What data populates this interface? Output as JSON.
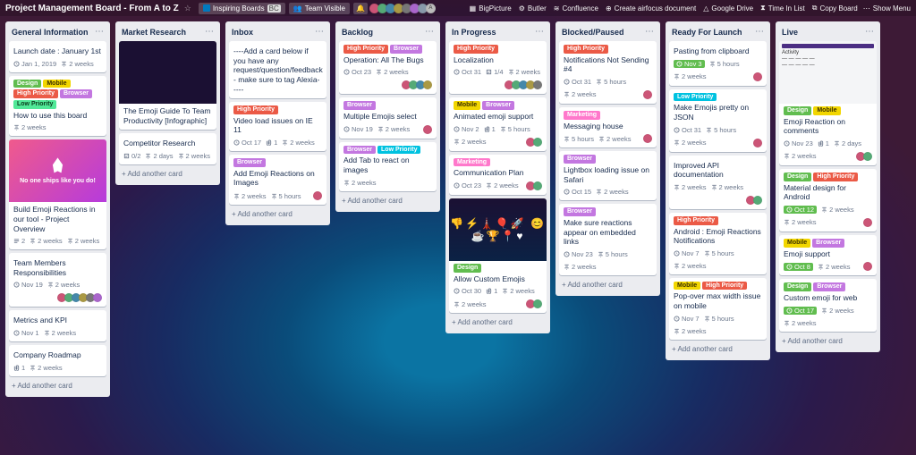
{
  "topbar": {
    "title": "Project Management Board - From A to Z",
    "team_button": "Inspiring Boards",
    "team_initials": "BC",
    "visibility": "Team Visible",
    "powerups": [
      "BigPicture",
      "Butler",
      "Confluence",
      "Create airfocus document",
      "Google Drive",
      "Time In List",
      "Copy Board"
    ],
    "show_menu": "Show Menu"
  },
  "add_card": "Add another card",
  "lists": [
    {
      "title": "General Information",
      "cards": [
        {
          "title": "Launch date : January 1st",
          "date": "Jan 1, 2019",
          "tl": "2 weeks"
        },
        {
          "labels": [
            [
              "green",
              "Design"
            ],
            [
              "yellow",
              "Mobile"
            ],
            [
              "red",
              "High Priority"
            ],
            [
              "purple",
              "Browser"
            ],
            [
              "lime",
              "Low Priority"
            ]
          ],
          "title": "How to use this board",
          "tl": "2 weeks"
        },
        {
          "cover": "rocket",
          "cover_text": "No one ships like you do!",
          "title": "Build Emoji Reactions in our tool - Project Overview",
          "sub": "2",
          "tl": "2 weeks",
          "tl2": "2 weeks"
        },
        {
          "title": "Team Members Responsibilities",
          "date": "Nov 19",
          "tl": "2 weeks",
          "avs": 6
        },
        {
          "title": "Metrics and KPI",
          "date": "Nov 1",
          "tl": "2 weeks"
        },
        {
          "title": "Company Roadmap",
          "att": "1",
          "tl": "2 weeks"
        }
      ]
    },
    {
      "title": "Market Research",
      "cards": [
        {
          "cover": "dark",
          "title": "The Emoji Guide To Team Productivity [Infographic]"
        },
        {
          "title": "Competitor Research",
          "check": "0/2",
          "tl": "2 days",
          "tl2": "2 weeks"
        }
      ]
    },
    {
      "title": "Inbox",
      "cards": [
        {
          "title": "----Add a card below if you have any request/question/feedback - make sure to tag Alexia-----"
        },
        {
          "labels": [
            [
              "red",
              "High Priority"
            ]
          ],
          "title": "Video load issues on IE 11",
          "date": "Oct 17",
          "att": "1",
          "tl": "2 weeks"
        },
        {
          "labels": [
            [
              "purple",
              "Browser"
            ]
          ],
          "title": "Add Emoji Reactions on Images",
          "tl": "2 weeks",
          "tl2": "5 hours",
          "avs": 1
        }
      ]
    },
    {
      "title": "Backlog",
      "cards": [
        {
          "labels": [
            [
              "red",
              "High Priority"
            ],
            [
              "purple",
              "Browser"
            ]
          ],
          "title": "Operation: All The Bugs",
          "date": "Oct 23",
          "tl": "2 weeks",
          "avs": 4
        },
        {
          "labels": [
            [
              "purple",
              "Browser"
            ]
          ],
          "title": "Multiple Emojis select",
          "date": "Nov 19",
          "tl": "2 weeks",
          "avs": 1
        },
        {
          "labels": [
            [
              "purple",
              "Browser"
            ],
            [
              "sky",
              "Low Priority"
            ]
          ],
          "title": "Add Tab to react on images",
          "tl": "2 weeks"
        }
      ]
    },
    {
      "title": "In Progress",
      "cards": [
        {
          "labels": [
            [
              "red",
              "High Priority"
            ]
          ],
          "title": "Localization",
          "date": "Oct 31",
          "check": "1/4",
          "tl": "2 weeks",
          "avs": 5
        },
        {
          "labels": [
            [
              "yellow",
              "Mobile"
            ],
            [
              "purple",
              "Browser"
            ]
          ],
          "title": "Animated emoji support",
          "date": "Nov 2",
          "att": "1",
          "tl": "5 hours",
          "tl2": "2 weeks",
          "avs": 2
        },
        {
          "labels": [
            [
              "pink",
              "Marketing"
            ]
          ],
          "title": "Communication Plan",
          "date": "Oct 23",
          "tl": "2 weeks",
          "avs": 2
        },
        {
          "cover": "emoji",
          "cover_text": "👎⚡🗼🎈🚀\n😊☕🏆📍♥",
          "labels": [
            [
              "green",
              "Design"
            ]
          ],
          "title": "Allow Custom Emojis",
          "date": "Oct 30",
          "att": "1",
          "tl": "2 weeks",
          "tl2": "2 weeks",
          "avs": 2
        }
      ]
    },
    {
      "title": "Blocked/Paused",
      "cards": [
        {
          "labels": [
            [
              "red",
              "High Priority"
            ]
          ],
          "title": "Notifications Not Sending #4",
          "date": "Oct 31",
          "tl": "5 hours",
          "tl2": "2 weeks",
          "avs": 1
        },
        {
          "labels": [
            [
              "pink",
              "Marketing"
            ]
          ],
          "title": "Messaging house",
          "tl": "5 hours",
          "tl2": "2 weeks",
          "avs": 1
        },
        {
          "labels": [
            [
              "purple",
              "Browser"
            ]
          ],
          "title": "Lightbox loading issue on Safari",
          "date": "Oct 15",
          "tl": "2 weeks"
        },
        {
          "labels": [
            [
              "purple",
              "Browser"
            ]
          ],
          "title": "Make sure reactions appear on embedded links",
          "date": "Nov 23",
          "tl": "5 hours",
          "tl2": "2 weeks"
        }
      ]
    },
    {
      "title": "Ready For Launch",
      "cards": [
        {
          "title": "Pasting from clipboard",
          "date": "Nov 3",
          "done": true,
          "tl": "5 hours",
          "tl2": "2 weeks",
          "avs": 1
        },
        {
          "labels": [
            [
              "sky",
              "Low Priority"
            ]
          ],
          "title": "Make Emojis pretty on JSON",
          "date": "Oct 31",
          "tl": "5 hours",
          "tl2": "2 weeks",
          "avs": 1
        },
        {
          "title": "Improved API documentation",
          "tl": "2 weeks",
          "tl2": "2 weeks",
          "avs": 2
        },
        {
          "labels": [
            [
              "red",
              "High Priority"
            ]
          ],
          "title": "Android : Emoji Reactions Notifications",
          "date": "Nov 7",
          "tl": "5 hours",
          "tl2": "2 weeks"
        },
        {
          "labels": [
            [
              "yellow",
              "Mobile"
            ],
            [
              "red",
              "High Priority"
            ]
          ],
          "title": "Pop-over max width issue on mobile",
          "date": "Nov 7",
          "tl": "5 hours",
          "tl2": "2 weeks"
        }
      ]
    },
    {
      "title": "Live",
      "cards": [
        {
          "screenshot": true,
          "labels": [
            [
              "green",
              "Design"
            ],
            [
              "yellow",
              "Mobile"
            ]
          ],
          "title": "Emoji Reaction on comments",
          "date": "Nov 23",
          "att": "1",
          "tl": "2 days",
          "tl2": "2 weeks",
          "avs": 2
        },
        {
          "labels": [
            [
              "green",
              "Design"
            ],
            [
              "red",
              "High Priority"
            ]
          ],
          "title": "Material design for Android",
          "date": "Oct 12",
          "done": true,
          "tl": "2 weeks",
          "tl2": "2 weeks",
          "avs": 1
        },
        {
          "labels": [
            [
              "yellow",
              "Mobile"
            ],
            [
              "purple",
              "Browser"
            ]
          ],
          "title": "Emoji support",
          "date": "Oct 8",
          "done": true,
          "tl": "2 weeks",
          "avs": 1
        },
        {
          "labels": [
            [
              "green",
              "Design"
            ],
            [
              "purple",
              "Browser"
            ]
          ],
          "title": "Custom emoji for web",
          "date": "Oct 17",
          "done": true,
          "tl": "2 weeks",
          "tl2": "2 weeks"
        }
      ]
    }
  ]
}
